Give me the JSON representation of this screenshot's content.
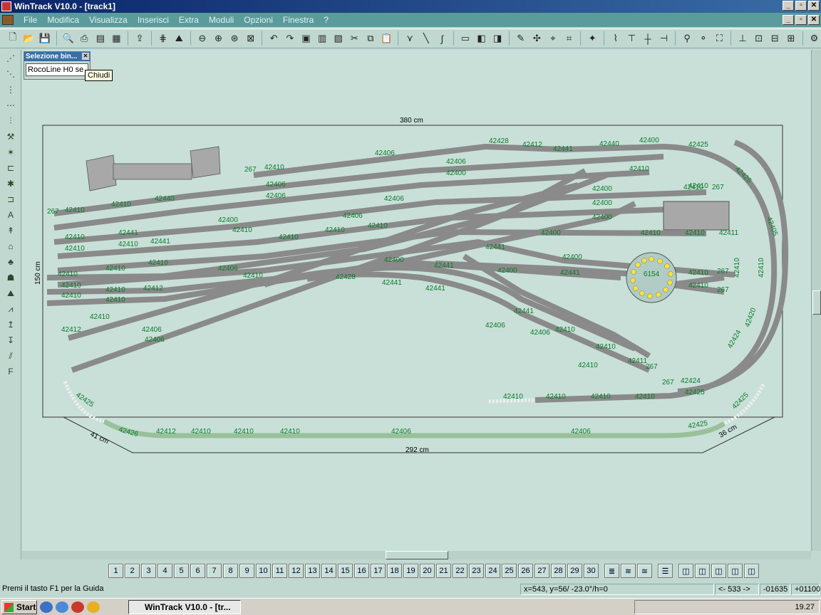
{
  "window": {
    "title": "WinTrack  V10.0 - [track1]"
  },
  "menu": [
    "File",
    "Modifica",
    "Visualizza",
    "Inserisci",
    "Extra",
    "Moduli",
    "Opzioni",
    "Finestra",
    "?"
  ],
  "selector": {
    "title": "Selezione bin...",
    "value": "RocoLine H0 se",
    "tooltip": "Chiudi"
  },
  "dimensions": {
    "top": "380 cm",
    "left": "150 cm",
    "bottom": "292 cm",
    "left_diag": "41 cm",
    "right_diag": "36 cm"
  },
  "track_labels": {
    "turntable": "6154",
    "codes": [
      "42428",
      "42412",
      "42441",
      "42440",
      "42400",
      "42425",
      "42406",
      "42410",
      "267",
      "42411",
      "42420",
      "42427",
      "42405",
      "42424",
      "42426",
      "42428"
    ]
  },
  "pages": [
    "1",
    "2",
    "3",
    "4",
    "5",
    "6",
    "7",
    "8",
    "9",
    "10",
    "11",
    "12",
    "13",
    "14",
    "15",
    "16",
    "17",
    "18",
    "19",
    "20",
    "21",
    "22",
    "23",
    "24",
    "25",
    "26",
    "27",
    "28",
    "29",
    "30"
  ],
  "status": {
    "help": "Premi il tasto F1 per la Guida",
    "coords": "x=543, y=56/ -23.0°/h=0",
    "scale": "<- 533 ->",
    "val1": "-01635",
    "val2": "+01100"
  },
  "taskbar": {
    "start": "Start",
    "task": "WinTrack  V10.0 - [tr...",
    "time": "19.27"
  },
  "colors": {
    "title": "#0a246a",
    "menu": "#5a9c9c",
    "track": "#a0a0a0",
    "label": "#0a7a2a"
  }
}
